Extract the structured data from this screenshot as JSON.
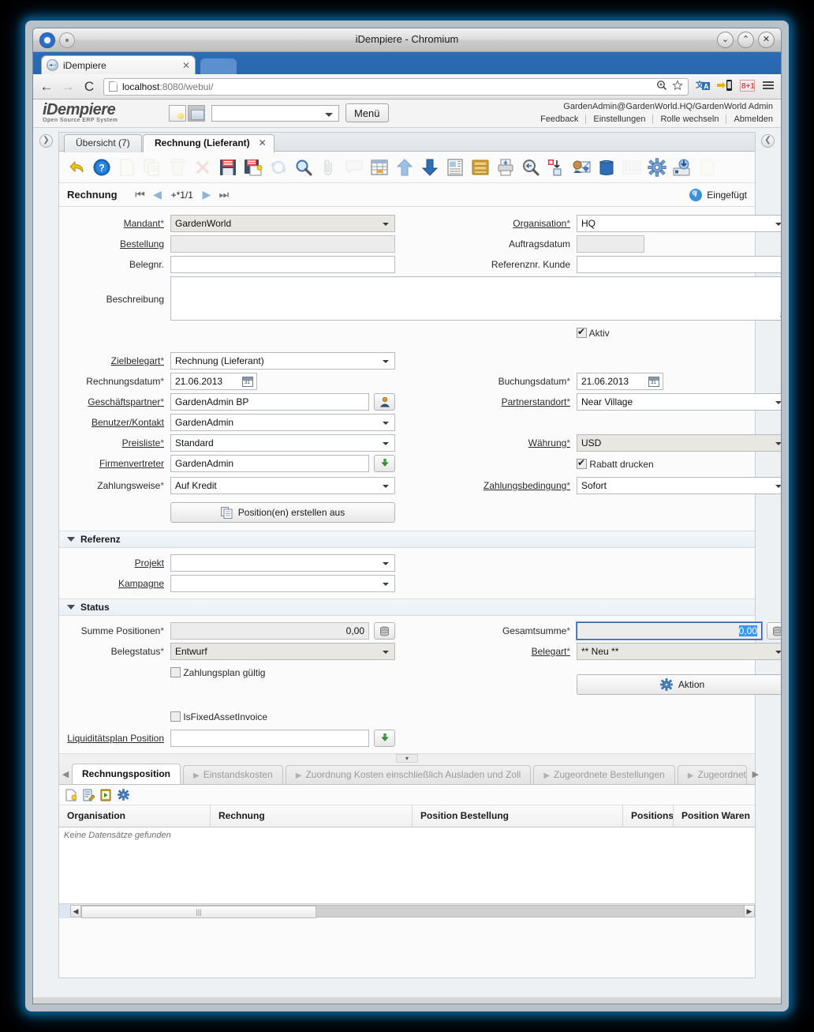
{
  "window": {
    "title": "iDempiere - Chromium",
    "buttons": [
      "⌄",
      "⌃",
      "✕"
    ]
  },
  "browser": {
    "tab_title": "iDempiere",
    "tab_close": "✕",
    "back": "←",
    "forward": "→",
    "reload": "C",
    "url_prefix": "localhost",
    "url_suffix": ":8080/webui/",
    "toolbar_icons": [
      "zoom-icon",
      "bookmark-star-icon",
      "translate-icon",
      "mobile-send-icon",
      "google-plus-icon",
      "menu-icon"
    ]
  },
  "app_header": {
    "brand_line1": "iDempiere",
    "brand_line2": "Open Source  ERP System",
    "menu_button": "Menü",
    "user": "GardenAdmin@GardenWorld.HQ/GardenWorld Admin",
    "links": [
      "Feedback",
      "Einstellungen",
      "Rolle wechseln",
      "Abmelden"
    ]
  },
  "window_tabs": {
    "overview": "Übersicht (7)",
    "active": "Rechnung (Lieferant)",
    "close": "✕"
  },
  "toolbar": [
    {
      "name": "undo-icon",
      "enabled": true
    },
    {
      "name": "help-icon",
      "enabled": true
    },
    {
      "name": "new-record-icon",
      "enabled": false
    },
    {
      "name": "copy-record-icon",
      "enabled": false
    },
    {
      "name": "delete-icon",
      "enabled": false
    },
    {
      "name": "delete-selection-icon",
      "enabled": false
    },
    {
      "name": "save-icon",
      "enabled": true
    },
    {
      "name": "save-create-new-icon",
      "enabled": true
    },
    {
      "name": "refresh-icon",
      "enabled": false
    },
    {
      "name": "find-icon",
      "enabled": true
    },
    {
      "name": "attachment-icon",
      "enabled": false
    },
    {
      "name": "chat-icon",
      "enabled": false
    },
    {
      "name": "grid-toggle-icon",
      "enabled": true
    },
    {
      "name": "parent-record-icon",
      "enabled": true
    },
    {
      "name": "detail-record-icon",
      "enabled": true
    },
    {
      "name": "report-icon",
      "enabled": true
    },
    {
      "name": "archive-icon",
      "enabled": true
    },
    {
      "name": "print-icon",
      "enabled": true
    },
    {
      "name": "print-preview-icon",
      "enabled": true
    },
    {
      "name": "export-icon",
      "enabled": true
    },
    {
      "name": "request-icon",
      "enabled": true
    },
    {
      "name": "product-info-icon",
      "enabled": true
    },
    {
      "name": "multi-window-icon",
      "enabled": false
    },
    {
      "name": "preference-icon",
      "enabled": true
    },
    {
      "name": "process-icon",
      "enabled": true
    },
    {
      "name": "new-window-icon",
      "enabled": false
    }
  ],
  "record_nav": {
    "title": "Rechnung",
    "first": "⏮",
    "prev": "◀",
    "position": "+*1/1",
    "next": "▶",
    "last": "⏭",
    "status": "Eingefügt",
    "status_icon": "info-icon"
  },
  "form": {
    "main": {
      "mandant": {
        "label": "Mandant",
        "required": true,
        "value": "GardenWorld"
      },
      "organisation": {
        "label": "Organisation",
        "required": true,
        "value": "HQ"
      },
      "bestellung": {
        "label": "Bestellung",
        "required": false,
        "value": ""
      },
      "auftragsdatum": {
        "label": "Auftragsdatum",
        "required": false,
        "value": ""
      },
      "belegnr": {
        "label": "Belegnr.",
        "required": false,
        "value": ""
      },
      "referenznr_kunde": {
        "label": "Referenznr. Kunde",
        "required": false,
        "value": ""
      },
      "beschreibung": {
        "label": "Beschreibung",
        "required": false,
        "value": ""
      },
      "aktiv": {
        "label": "Aktiv",
        "checked": true
      },
      "zielbelegart": {
        "label": "Zielbelegart",
        "required": true,
        "value": "Rechnung (Lieferant)"
      },
      "rechnungsdatum": {
        "label": "Rechnungsdatum",
        "required": true,
        "value": "21.06.2013"
      },
      "buchungsdatum": {
        "label": "Buchungsdatum",
        "required": true,
        "value": "21.06.2013"
      },
      "geschaeftspartner": {
        "label": "Geschäftspartner",
        "required": true,
        "value": "GardenAdmin BP"
      },
      "partnerstandort": {
        "label": "Partnerstandort",
        "required": true,
        "value": "Near Village"
      },
      "benutzer_kontakt": {
        "label": "Benutzer/Kontakt",
        "required": false,
        "value": "GardenAdmin"
      },
      "preisliste": {
        "label": "Preisliste",
        "required": true,
        "value": "Standard"
      },
      "waehrung": {
        "label": "Währung",
        "required": true,
        "value": "USD"
      },
      "firmenvertreter": {
        "label": "Firmenvertreter",
        "required": false,
        "value": "GardenAdmin"
      },
      "rabatt_drucken": {
        "label": "Rabatt drucken",
        "checked": true
      },
      "zahlungsweise": {
        "label": "Zahlungsweise",
        "required": true,
        "value": "Auf Kredit"
      },
      "zahlungsbedingung": {
        "label": "Zahlungsbedingung",
        "required": true,
        "value": "Sofort"
      },
      "create_lines_button": "Position(en) erstellen aus"
    },
    "referenz": {
      "section_title": "Referenz",
      "projekt": {
        "label": "Projekt",
        "required": false,
        "value": ""
      },
      "kampagne": {
        "label": "Kampagne",
        "required": false,
        "value": ""
      }
    },
    "status": {
      "section_title": "Status",
      "summe_positionen": {
        "label": "Summe Positionen",
        "required": true,
        "value": "0,00"
      },
      "gesamtsumme": {
        "label": "Gesamtsumme",
        "required": true,
        "value": "0,00",
        "focused": true,
        "selected": true
      },
      "belegstatus": {
        "label": "Belegstatus",
        "required": true,
        "value": "Entwurf"
      },
      "belegart": {
        "label": "Belegart",
        "required": true,
        "value": "** Neu **"
      },
      "zahlungsplan_gueltig": {
        "label": "Zahlungsplan gültig",
        "checked": false
      },
      "aktion_button": "Aktion",
      "is_fixed_asset_invoice": {
        "label": "IsFixedAssetInvoice",
        "checked": false
      },
      "liquiditaetsplan_position": {
        "label": "Liquiditätsplan Position",
        "required": false,
        "value": ""
      }
    }
  },
  "detail_panel": {
    "tabs": [
      {
        "label": "Rechnungsposition",
        "active": true
      },
      {
        "label": "Einstandskosten",
        "active": false
      },
      {
        "label": "Zuordnung Kosten einschließlich Ausladen und Zoll",
        "active": false
      },
      {
        "label": "Zugeordnete Bestellungen",
        "active": false
      },
      {
        "label": "Zugeordnete W",
        "active": false
      }
    ],
    "tab_prev": "◀",
    "tab_next": "▶",
    "grid_tools": [
      "new-record-icon",
      "edit-record-icon",
      "quick-entry-icon",
      "process-icon"
    ],
    "columns": [
      "Organisation",
      "Rechnung",
      "Position Bestellung",
      "Positionsr",
      "Position Waren"
    ],
    "empty_message": "Keine Datensätze gefunden",
    "scroll_left": "◀",
    "scroll_right": "▶"
  },
  "colors": {
    "accent_blue": "#2b6cb5",
    "selection_blue": "#3399ff",
    "panel_bg": "#fbfbfb",
    "section_bg": "#eef4fa"
  }
}
